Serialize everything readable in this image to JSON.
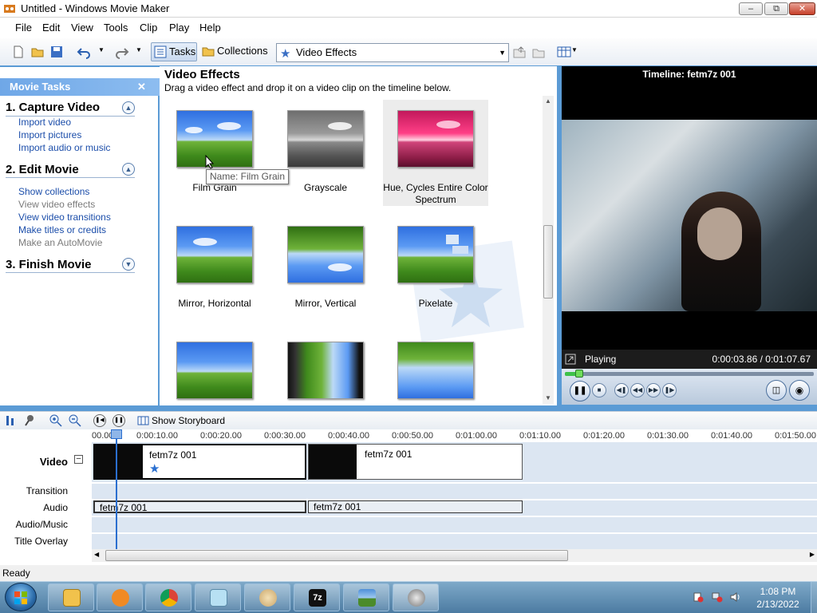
{
  "window": {
    "title": "Untitled - Windows Movie Maker"
  },
  "menu": [
    "File",
    "Edit",
    "View",
    "Tools",
    "Clip",
    "Play",
    "Help"
  ],
  "toolbar": {
    "tasks_label": "Tasks",
    "collections_label": "Collections",
    "collection_select": "Video Effects"
  },
  "tasks": {
    "header": "Movie Tasks",
    "sections": [
      {
        "title": "1. Capture Video",
        "links": [
          {
            "label": "Import video",
            "enabled": true
          },
          {
            "label": "Import pictures",
            "enabled": true
          },
          {
            "label": "Import audio or music",
            "enabled": true
          }
        ]
      },
      {
        "title": "2. Edit Movie",
        "links": [
          {
            "label": "Show collections",
            "enabled": true
          },
          {
            "label": "View video effects",
            "enabled": false
          },
          {
            "label": "View video transitions",
            "enabled": true
          },
          {
            "label": "Make titles or credits",
            "enabled": true
          },
          {
            "label": "Make an AutoMovie",
            "enabled": false
          }
        ]
      },
      {
        "title": "3. Finish Movie",
        "links": []
      }
    ]
  },
  "effects": {
    "title": "Video Effects",
    "subtitle": "Drag a video effect and drop it on a video clip on the timeline below.",
    "items": [
      {
        "label": "Film Grain"
      },
      {
        "label": "Grayscale"
      },
      {
        "label": "Hue, Cycles Entire Color Spectrum"
      },
      {
        "label": "Mirror, Horizontal"
      },
      {
        "label": "Mirror, Vertical"
      },
      {
        "label": "Pixelate"
      }
    ],
    "tooltip": "Name: Film Grain"
  },
  "preview": {
    "title": "Timeline: fetm7z 001",
    "state": "Playing",
    "time": "0:00:03.86 / 0:01:07.67",
    "progress": 0.057
  },
  "timeline": {
    "storyboard_label": "Show Storyboard",
    "ruler": [
      "00.00",
      "0:00:10.00",
      "0:00:20.00",
      "0:00:30.00",
      "0:00:40.00",
      "0:00:50.00",
      "0:01:00.00",
      "0:01:10.00",
      "0:01:20.00",
      "0:01:30.00",
      "0:01:40.00",
      "0:01:50.00"
    ],
    "tracks": [
      "Video",
      "Transition",
      "Audio",
      "Audio/Music",
      "Title Overlay"
    ],
    "video_clips": [
      {
        "name": "fetm7z 001"
      },
      {
        "name": "fetm7z 001"
      }
    ],
    "audio_clips": [
      {
        "name": "fetm7z 001"
      },
      {
        "name": "fetm7z 001"
      }
    ]
  },
  "status": "Ready",
  "clock": {
    "time": "1:08 PM",
    "date": "2/13/2022"
  }
}
